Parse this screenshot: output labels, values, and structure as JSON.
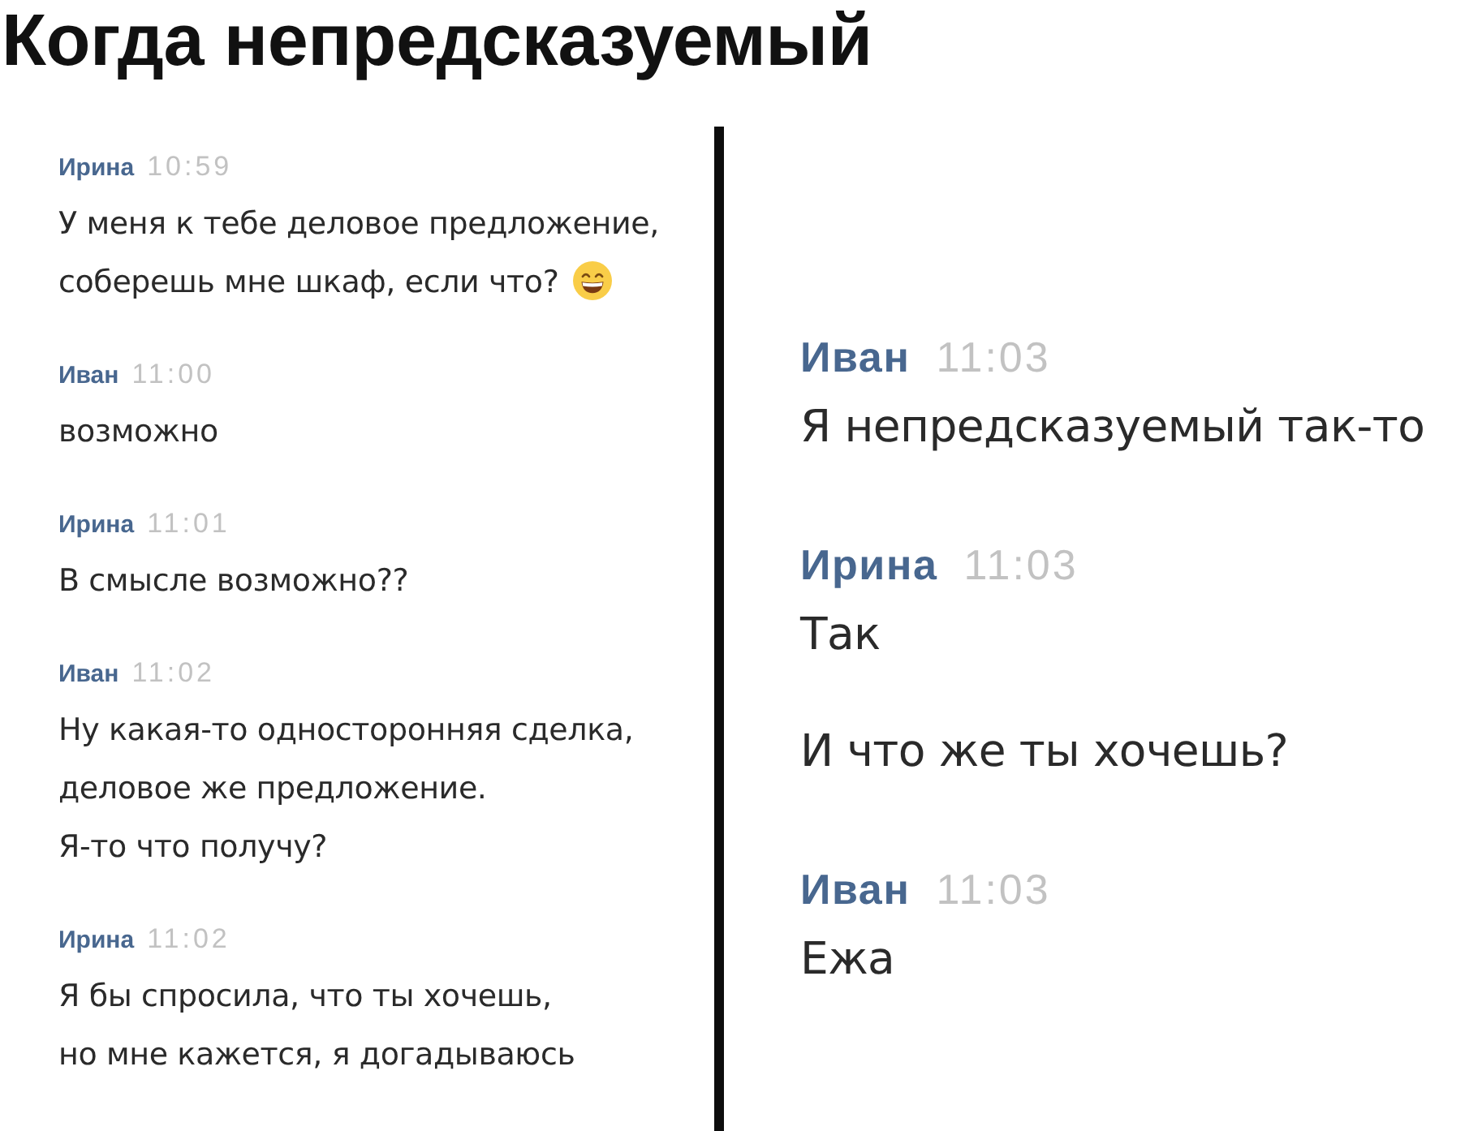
{
  "title": "Когда непредсказуемый",
  "panels": [
    {
      "messages": [
        {
          "author": "Ирина",
          "time": "10:59",
          "paragraphs": [
            {
              "text": "У меня к тебе деловое предложение,"
            },
            {
              "text": "соберешь мне шкаф, если что?",
              "emoji": true
            }
          ]
        },
        {
          "author": "Иван",
          "time": "11:00",
          "paragraphs": [
            {
              "text": "возможно"
            }
          ]
        },
        {
          "author": "Ирина",
          "time": "11:01",
          "paragraphs": [
            {
              "text": "В смысле возможно??"
            }
          ]
        },
        {
          "author": "Иван",
          "time": "11:02",
          "paragraphs": [
            {
              "text": "Ну какая-то односторонняя сделка,\nделовое же предложение.\nЯ-то что получу?"
            }
          ]
        },
        {
          "author": "Ирина",
          "time": "11:02",
          "paragraphs": [
            {
              "text": "Я бы спросила, что ты хочешь,\nно мне кажется, я догадываюсь"
            }
          ]
        }
      ]
    },
    {
      "messages": [
        {
          "author": "Иван",
          "time": "11:03",
          "paragraphs": [
            {
              "text": "Я непредсказуемый так-то"
            }
          ]
        },
        {
          "author": "Ирина",
          "time": "11:03",
          "paragraphs": [
            {
              "text": "Так"
            },
            {
              "text": "И что же ты хочешь?"
            }
          ]
        },
        {
          "author": "Иван",
          "time": "11:03",
          "paragraphs": [
            {
              "text": "Ежа"
            }
          ]
        }
      ]
    }
  ]
}
